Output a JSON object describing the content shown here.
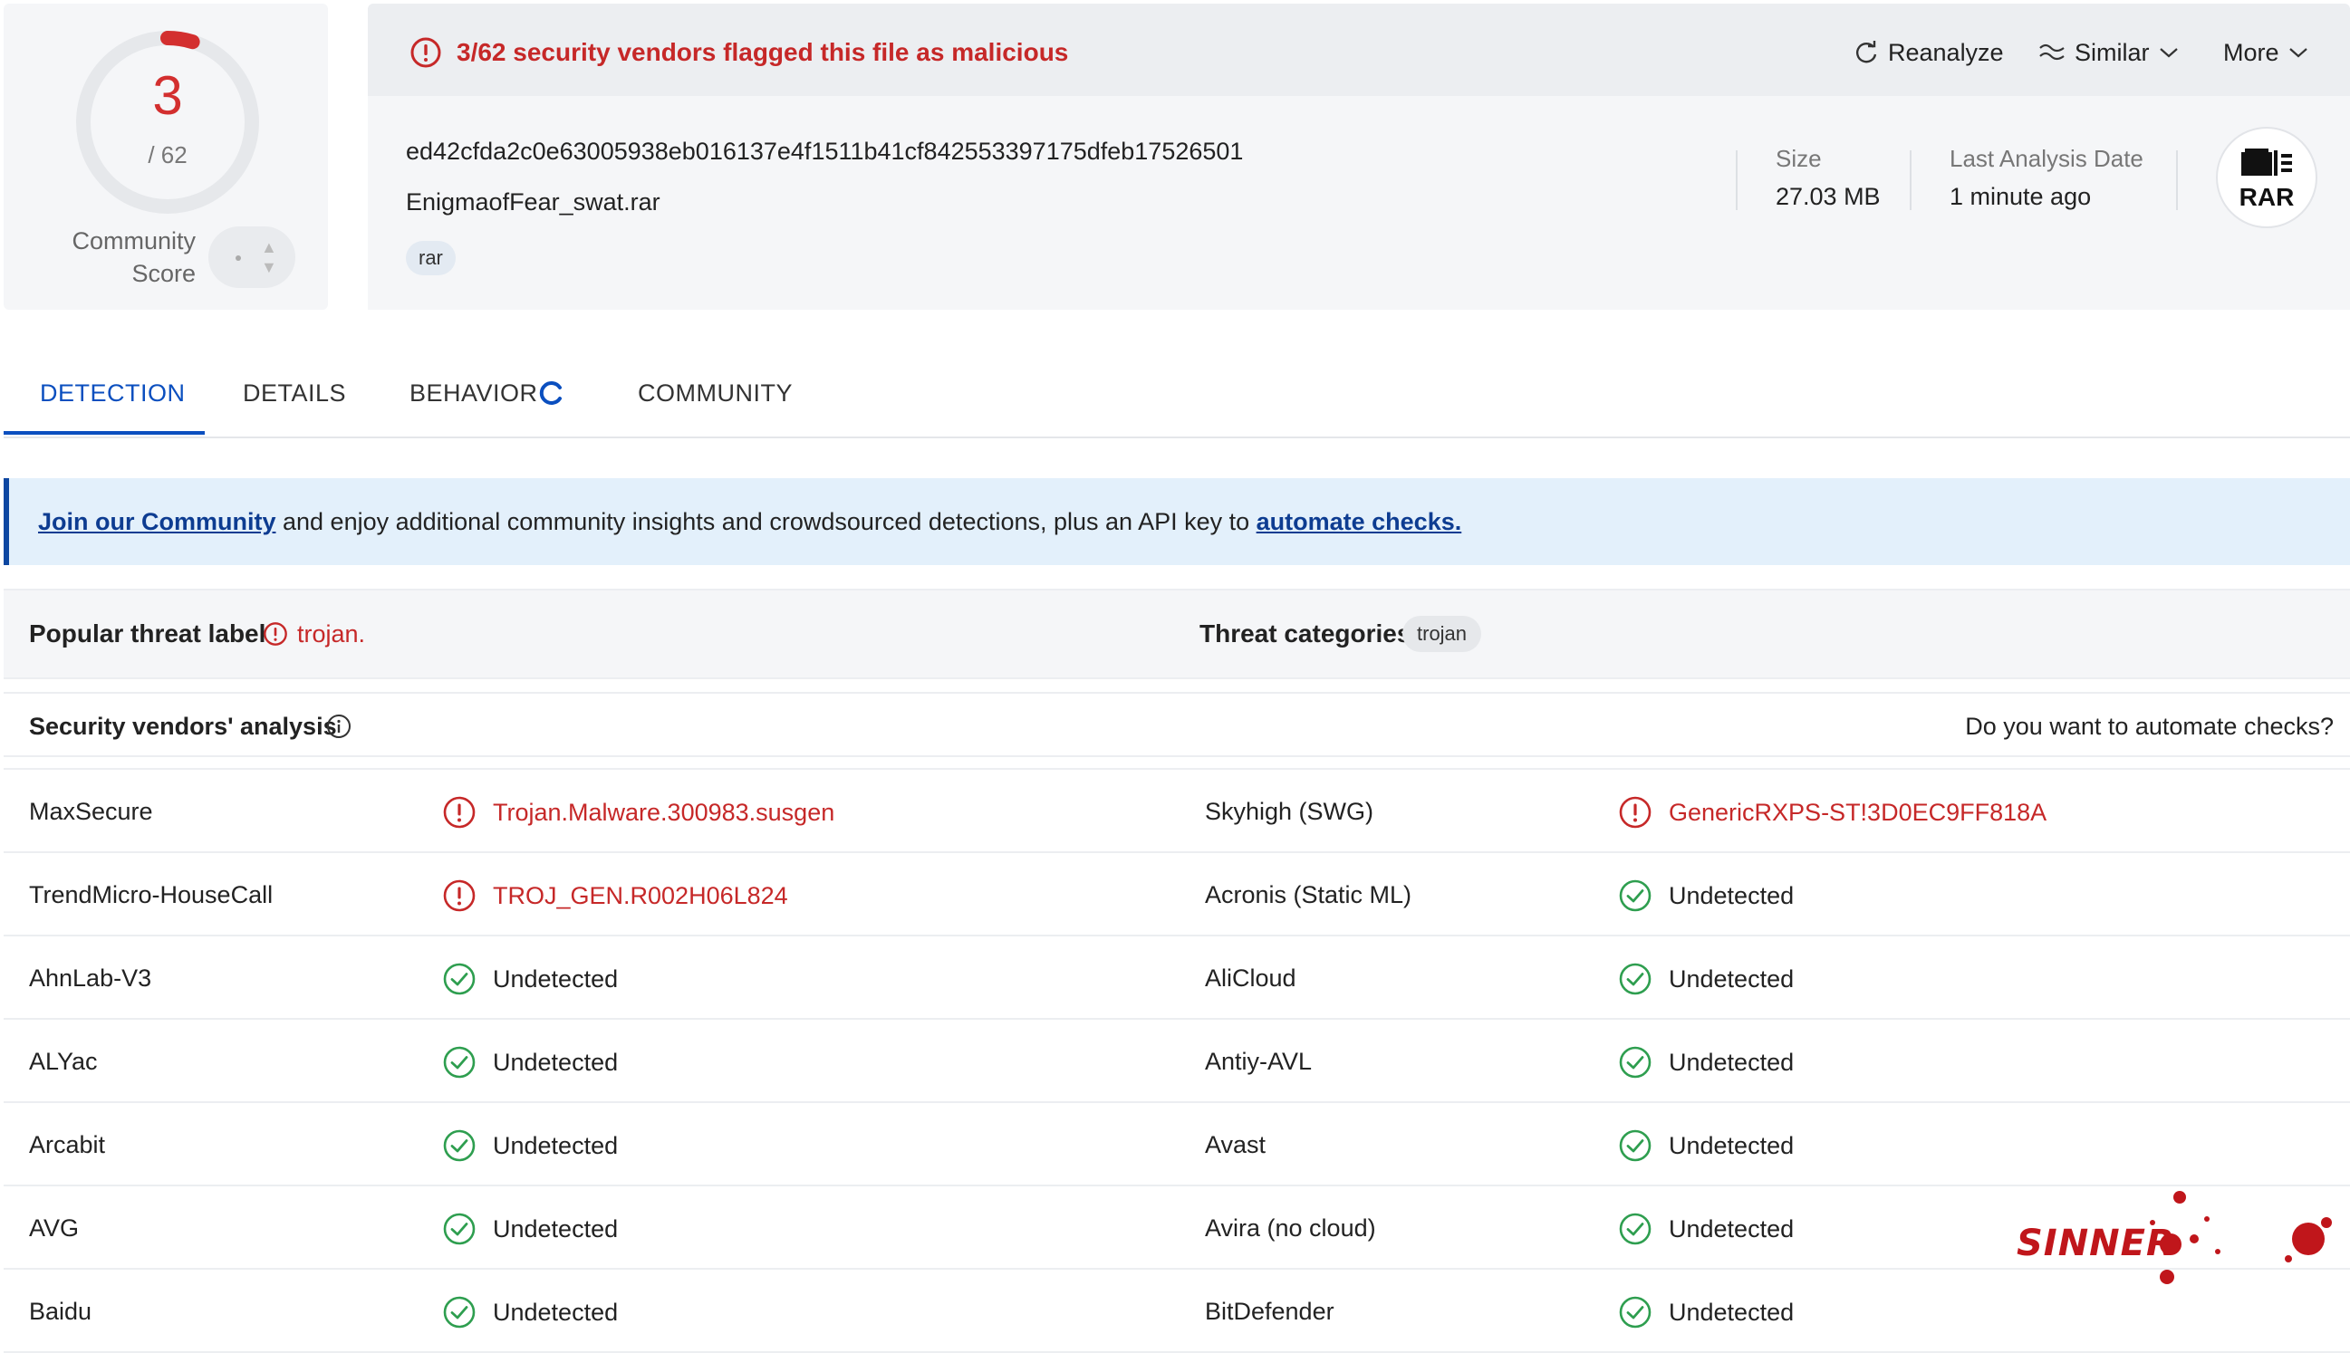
{
  "score": {
    "detections": "3",
    "total": "/ 62",
    "detection_fraction": 0.048,
    "community_label": "Community Score"
  },
  "alert": {
    "text": "3/62 security vendors flagged this file as malicious"
  },
  "actions": {
    "reanalyze": "Reanalyze",
    "similar": "Similar",
    "more": "More"
  },
  "file": {
    "hash": "ed42cfda2c0e63005938eb016137e4f1511b41cf842553397175dfeb17526501",
    "name": "EnigmaofFear_swat.rar",
    "tag": "rar",
    "size_label": "Size",
    "size_value": "27.03 MB",
    "date_label": "Last Analysis Date",
    "date_value": "1 minute ago",
    "type_badge": "RAR"
  },
  "tabs": [
    {
      "label": "DETECTION"
    },
    {
      "label": "DETAILS"
    },
    {
      "label": "BEHAVIOR"
    },
    {
      "label": "COMMUNITY"
    }
  ],
  "banner": {
    "link1": "Join our Community",
    "middle": " and enjoy additional community insights and crowdsourced detections, plus an API key to ",
    "link2": "automate checks."
  },
  "threat": {
    "popular_label": "Popular threat label",
    "popular_value": "trojan.",
    "categories_label": "Threat categories",
    "category_chip": "trojan"
  },
  "vendors_header": {
    "title": "Security vendors' analysis",
    "right": "Do you want to automate checks?"
  },
  "vendors": [
    {
      "left_name": "MaxSecure",
      "left_result": "Trojan.Malware.300983.susgen",
      "left_status": "malicious",
      "right_name": "Skyhigh (SWG)",
      "right_result": "GenericRXPS-ST!3D0EC9FF818A",
      "right_status": "malicious"
    },
    {
      "left_name": "TrendMicro-HouseCall",
      "left_result": "TROJ_GEN.R002H06L824",
      "left_status": "malicious",
      "right_name": "Acronis (Static ML)",
      "right_result": "Undetected",
      "right_status": "clean"
    },
    {
      "left_name": "AhnLab-V3",
      "left_result": "Undetected",
      "left_status": "clean",
      "right_name": "AliCloud",
      "right_result": "Undetected",
      "right_status": "clean"
    },
    {
      "left_name": "ALYac",
      "left_result": "Undetected",
      "left_status": "clean",
      "right_name": "Antiy-AVL",
      "right_result": "Undetected",
      "right_status": "clean"
    },
    {
      "left_name": "Arcabit",
      "left_result": "Undetected",
      "left_status": "clean",
      "right_name": "Avast",
      "right_result": "Undetected",
      "right_status": "clean"
    },
    {
      "left_name": "AVG",
      "left_result": "Undetected",
      "left_status": "clean",
      "right_name": "Avira (no cloud)",
      "right_result": "Undetected",
      "right_status": "clean"
    },
    {
      "left_name": "Baidu",
      "left_result": "Undetected",
      "left_status": "clean",
      "right_name": "BitDefender",
      "right_result": "Undetected",
      "right_status": "clean"
    }
  ],
  "watermark": {
    "text": "SINNER"
  },
  "colors": {
    "malicious": "#c62828",
    "clean": "#2e9e4f",
    "accent": "#0b4fbf",
    "banner_bg": "#e3f0fb"
  },
  "icons": {
    "alert": "alert-circle-icon",
    "reanalyze": "refresh-icon",
    "similar": "similar-waves-icon",
    "chevron": "chevron-down-icon",
    "info": "info-circle-icon",
    "check": "check-circle-icon",
    "file_type": "archive-file-icon",
    "loading": "spinner-icon"
  }
}
